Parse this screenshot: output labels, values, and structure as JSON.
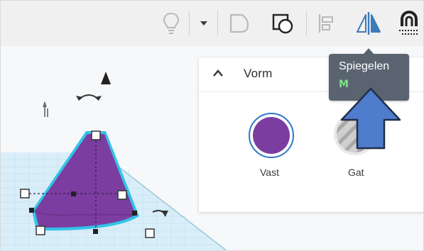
{
  "toolbar": {
    "buttons": [
      {
        "icon": "lightbulb-icon"
      },
      {
        "icon": "dropdown-arrow-icon"
      },
      {
        "icon": "group-icon"
      },
      {
        "icon": "ungroup-icon"
      },
      {
        "icon": "align-icon"
      },
      {
        "icon": "mirror-icon"
      },
      {
        "icon": "magnet-icon"
      }
    ]
  },
  "panel": {
    "title": "Vorm",
    "options": [
      {
        "label": "Vast",
        "color": "#7b3ea0",
        "selected": true
      },
      {
        "label": "Gat",
        "color": "#bdbdbd",
        "selected": false
      }
    ]
  },
  "tooltip": {
    "title": "Spiegelen",
    "shortcut": "M"
  },
  "colors": {
    "shape_fill": "#7b3ea0",
    "selection_outline": "#33c3e8",
    "grid": "#c9e7f5",
    "arrow_fill": "#4f7ccc",
    "accent_blue": "#3d7ab8"
  }
}
